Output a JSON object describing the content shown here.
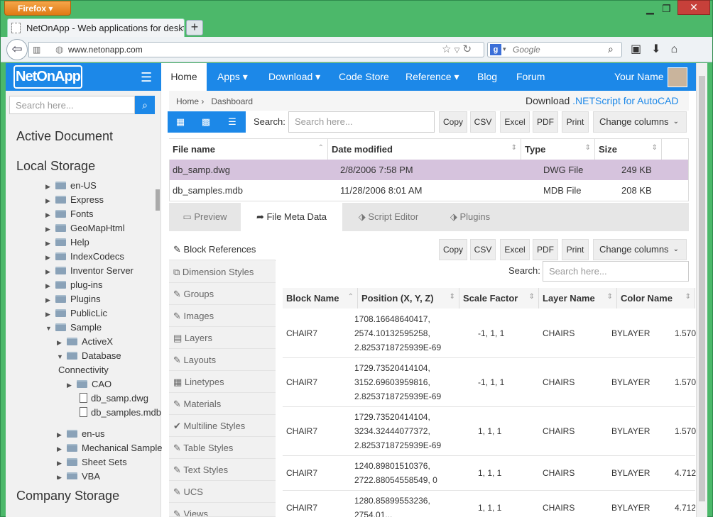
{
  "browser": {
    "menu_button": "Firefox",
    "tab_title": "NetOnApp - Web applications for deskt...",
    "tab_close": "×",
    "new_tab": "+",
    "url": "www.netonapp.com",
    "search_placeholder": "Google",
    "search_engine_letter": "g"
  },
  "app": {
    "logo": "NetOnApp",
    "sidebar_search_placeholder": "Search here...",
    "nav": [
      {
        "label": "Home"
      },
      {
        "label": "Apps ▾"
      },
      {
        "label": "Download ▾"
      },
      {
        "label": "Code Store"
      },
      {
        "label": "Reference ▾"
      },
      {
        "label": "Blog"
      },
      {
        "label": "Forum"
      }
    ],
    "user_name": "Your Name"
  },
  "sidebar": {
    "active_document": "Active Document",
    "local_storage": "Local Storage",
    "company_storage": "Company Storage",
    "tree": [
      {
        "label": "en-US"
      },
      {
        "label": "Express"
      },
      {
        "label": "Fonts"
      },
      {
        "label": "GeoMapHtml"
      },
      {
        "label": "Help"
      },
      {
        "label": "IndexCodecs"
      },
      {
        "label": "Inventor Server"
      },
      {
        "label": "plug-ins"
      },
      {
        "label": "Plugins"
      },
      {
        "label": "PublicLic"
      },
      {
        "label": "Sample"
      },
      {
        "label": "ActiveX"
      },
      {
        "label": "Database"
      },
      {
        "label": "Connectivity"
      },
      {
        "label": "CAO"
      },
      {
        "label": "db_samp.dwg"
      },
      {
        "label": "db_samples.mdb"
      },
      {
        "label": "en-us"
      },
      {
        "label": "Mechanical Sample"
      },
      {
        "label": "Sheet Sets"
      },
      {
        "label": "VBA"
      }
    ]
  },
  "breadcrumb": {
    "home": "Home",
    "sep": "›",
    "current": "Dashboard"
  },
  "download": {
    "prefix": "Download ",
    "link": ".NETScript for AutoCAD"
  },
  "toolbar": {
    "search_label": "Search:",
    "search_placeholder": "Search here...",
    "buttons": [
      "Copy",
      "CSV",
      "Excel",
      "PDF",
      "Print"
    ],
    "change_columns": "Change columns"
  },
  "file_table": {
    "columns": [
      "File name",
      "Date modified",
      "Type",
      "Size"
    ],
    "rows": [
      {
        "name": "db_samp.dwg",
        "date": "2/8/2006 7:58 PM",
        "type": "DWG File",
        "size": "249 KB"
      },
      {
        "name": "db_samples.mdb",
        "date": "11/28/2006 8:01 AM",
        "type": "MDB File",
        "size": "208 KB"
      }
    ]
  },
  "tabs": [
    {
      "label": "Preview"
    },
    {
      "label": "File Meta Data"
    },
    {
      "label": "Script Editor"
    },
    {
      "label": "Plugins"
    }
  ],
  "meta_menu": [
    {
      "label": "Block References"
    },
    {
      "label": "Dimension Styles"
    },
    {
      "label": "Groups"
    },
    {
      "label": "Images"
    },
    {
      "label": "Layers"
    },
    {
      "label": "Layouts"
    },
    {
      "label": "Linetypes"
    },
    {
      "label": "Materials"
    },
    {
      "label": "Multiline Styles"
    },
    {
      "label": "Table Styles"
    },
    {
      "label": "Text Styles"
    },
    {
      "label": "UCS"
    },
    {
      "label": "Views"
    }
  ],
  "block_table": {
    "columns": [
      "Block Name",
      "Position (X, Y, Z)",
      "Scale Factor",
      "Layer Name",
      "Color Name"
    ],
    "rows": [
      {
        "name": "CHAIR7",
        "pos": [
          "1708.16648640417,",
          "2574.10132595258,",
          "2.8253718725939E-69"
        ],
        "scale": "-1, 1, 1",
        "layer": "CHAIRS",
        "color": "BYLAYER",
        "extra": "1.570"
      },
      {
        "name": "CHAIR7",
        "pos": [
          "1729.73520414104,",
          "3152.69603959816,",
          "2.8253718725939E-69"
        ],
        "scale": "-1, 1, 1",
        "layer": "CHAIRS",
        "color": "BYLAYER",
        "extra": "1.570"
      },
      {
        "name": "CHAIR7",
        "pos": [
          "1729.73520414104,",
          "3234.32444077372,",
          "2.8253718725939E-69"
        ],
        "scale": "1, 1, 1",
        "layer": "CHAIRS",
        "color": "BYLAYER",
        "extra": "1.570"
      },
      {
        "name": "CHAIR7",
        "pos": [
          "1240.89801510376,",
          "2722.88054558549, 0",
          ""
        ],
        "scale": "1, 1, 1",
        "layer": "CHAIRS",
        "color": "BYLAYER",
        "extra": "4.712"
      },
      {
        "name": "CHAIR7",
        "pos": [
          "1280.85899553236,",
          "2754.01..."
        ],
        "scale": "1, 1, 1",
        "layer": "CHAIRS",
        "color": "BYLAYER",
        "extra": "4.712"
      }
    ]
  },
  "colors": {
    "accent": "#1c88e8",
    "selected_row": "#d6c3dd",
    "firefox_orange": "#e8861f",
    "window_green": "#4cb86a"
  }
}
